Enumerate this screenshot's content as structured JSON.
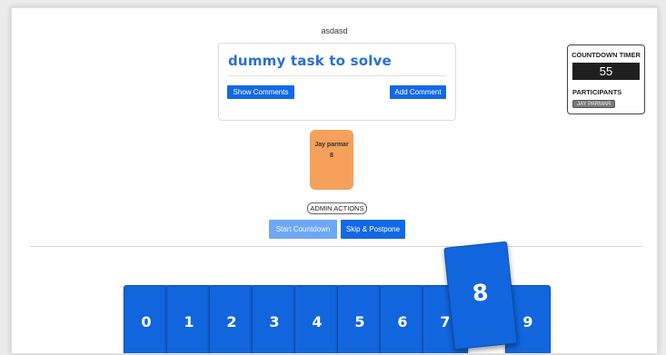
{
  "room": {
    "name": "asdasd"
  },
  "task": {
    "title": "dummy task to solve",
    "show_comments_label": "Show Comments",
    "add_comment_label": "Add Comment"
  },
  "timer": {
    "title": "COUNTDOWN TIMER",
    "value": "55",
    "participants_title": "PARTICIPANTS",
    "participants": [
      "JAY PARMAR"
    ]
  },
  "player": {
    "name": "Jay parmar",
    "vote": "8"
  },
  "admin": {
    "label": "ADMIN ACTIONS",
    "start_label": "Start Countdown",
    "skip_label": "Skip & Postpone"
  },
  "deck": {
    "cards": [
      "0",
      "1",
      "2",
      "3",
      "4",
      "5",
      "6",
      "7",
      "8",
      "9"
    ],
    "selected": "8"
  },
  "colors": {
    "primary": "#1169e8",
    "primary_disabled": "#6ea8f5",
    "card_blue": "#1166dd",
    "player_card": "#f5a15b",
    "timer_bg": "#1f1f1f"
  }
}
